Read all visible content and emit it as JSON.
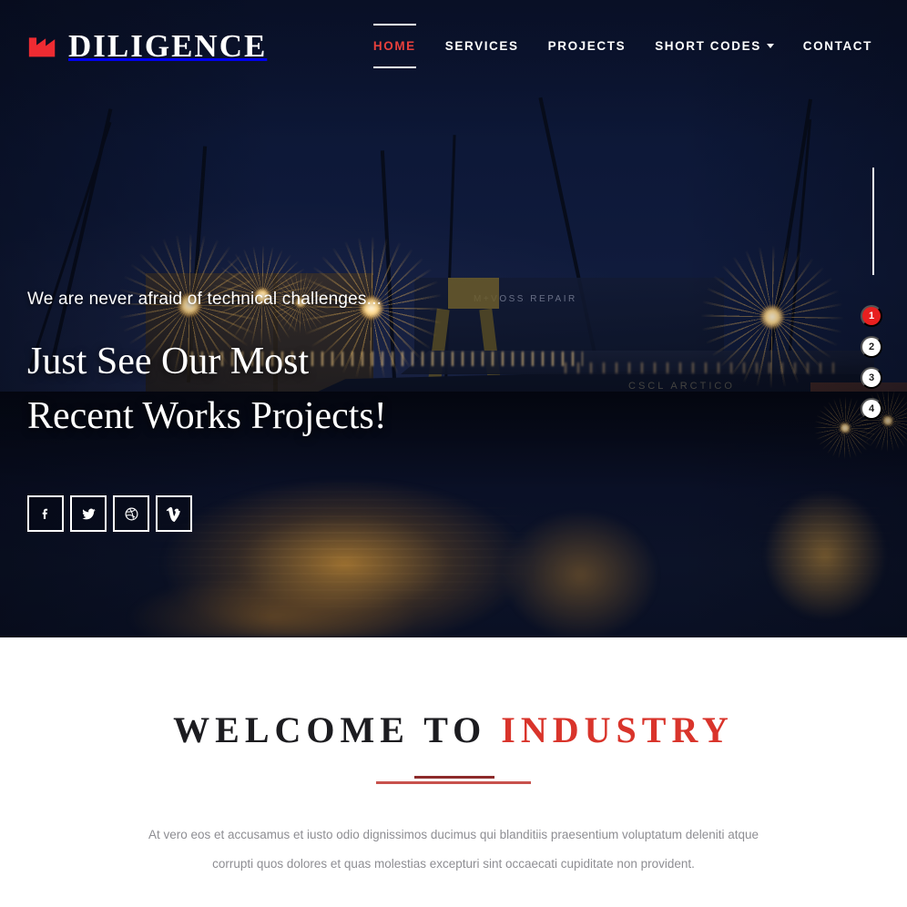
{
  "header": {
    "logo_icon": "factory-icon",
    "brand_name": "DILIGENCE",
    "accent_color": "#e8403c",
    "nav": [
      {
        "label": "HOME",
        "active": true,
        "has_dropdown": false
      },
      {
        "label": "SERVICES",
        "active": false,
        "has_dropdown": false
      },
      {
        "label": "PROJECTS",
        "active": false,
        "has_dropdown": false
      },
      {
        "label": "SHORT CODES",
        "active": false,
        "has_dropdown": true
      },
      {
        "label": "CONTACT",
        "active": false,
        "has_dropdown": false
      }
    ]
  },
  "hero": {
    "subtitle": "We are never afraid of technical challenges...",
    "title_line1": "Just See Our Most",
    "title_line2": "Recent Works Projects!",
    "background_scene": "night-shipyard-harbour-photo",
    "ship_name": "CSCL ARCTICO",
    "building_sign": "M+VOSS REPAIR",
    "socials": [
      {
        "name": "facebook-icon",
        "label": "f"
      },
      {
        "name": "twitter-icon",
        "label": "t"
      },
      {
        "name": "dribbble-icon",
        "label": "d"
      },
      {
        "name": "vimeo-icon",
        "label": "v"
      }
    ],
    "slider": {
      "dots": [
        "1",
        "2",
        "3",
        "4"
      ],
      "active_index": 0,
      "active_color": "#e8201f",
      "inactive_color": "#ffffff"
    }
  },
  "welcome": {
    "title_part1": "WELCOME TO ",
    "title_accent": "INDUSTRY",
    "accent_color": "#d9342b",
    "paragraph": "At vero eos et accusamus et iusto odio dignissimos ducimus qui blanditiis praesentium voluptatum deleniti atque corrupti quos dolores et quas molestias excepturi sint occaecati cupiditate non provident."
  }
}
